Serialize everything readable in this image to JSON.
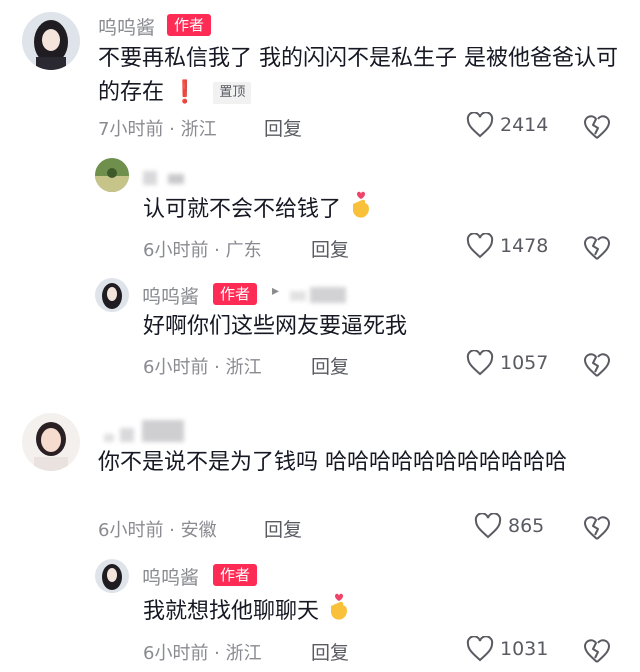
{
  "comments": [
    {
      "username": "呜呜酱",
      "badge": "作者",
      "text": "不要再私信我了 我的闪闪不是私生子 是被他爸爸认可的存在",
      "alert_glyph": "❗",
      "pin_label": "置顶",
      "meta": "7小时前 · 浙江",
      "reply_label": "回复",
      "likes": "2414"
    },
    {
      "username": "",
      "text": "认可就不会不给钱了",
      "emoji": "finger-heart-icon",
      "meta": "6小时前 · 广东",
      "reply_label": "回复",
      "likes": "1478"
    },
    {
      "username": "呜呜酱",
      "badge": "作者",
      "reply_arrow": "▸",
      "text": "好啊你们这些网友要逼死我",
      "meta": "6小时前 · 浙江",
      "reply_label": "回复",
      "likes": "1057"
    },
    {
      "username": "",
      "text": "你不是说不是为了钱吗 哈哈哈哈哈哈哈哈哈哈哈",
      "meta": "6小时前 · 安徽",
      "reply_label": "回复",
      "likes": "865"
    },
    {
      "username": "呜呜酱",
      "badge": "作者",
      "text": "我就想找他聊聊天",
      "emoji": "finger-heart-icon",
      "meta": "6小时前 · 浙江",
      "reply_label": "回复",
      "likes": "1031"
    }
  ],
  "colors": {
    "accent": "#fe2c55",
    "muted": "#8a8b91",
    "text": "#161823"
  }
}
